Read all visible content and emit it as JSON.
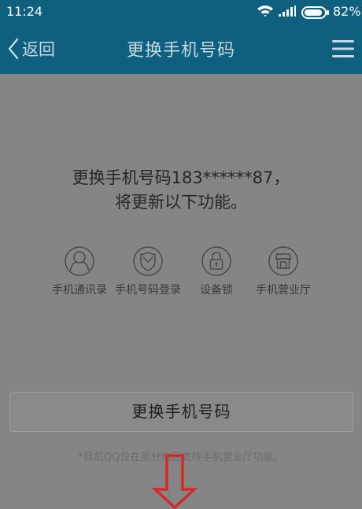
{
  "status_bar": {
    "time": "11:24",
    "battery": "82%",
    "icons": [
      "wifi-icon",
      "signal-icon",
      "battery-icon"
    ]
  },
  "header": {
    "back_label": "返回",
    "title": "更换手机号码",
    "menu_icon": "menu-icon"
  },
  "main": {
    "headline_line1": "更换手机号码183******87，",
    "headline_line2": "将更新以下功能。",
    "features": [
      {
        "label": "手机通讯录",
        "icon": "contacts-icon"
      },
      {
        "label": "手机号码登录",
        "icon": "shield-icon"
      },
      {
        "label": "设备锁",
        "icon": "lock-icon"
      },
      {
        "label": "手机营业厅",
        "icon": "store-icon"
      }
    ],
    "change_button_label": "更换手机号码",
    "note": "*目前QQ仅在部分地区支持手机营业厅功能。"
  },
  "colors": {
    "header_bg": "#0f5f7e",
    "content_bg": "#858585",
    "annotation_arrow": "#d42a2a"
  }
}
